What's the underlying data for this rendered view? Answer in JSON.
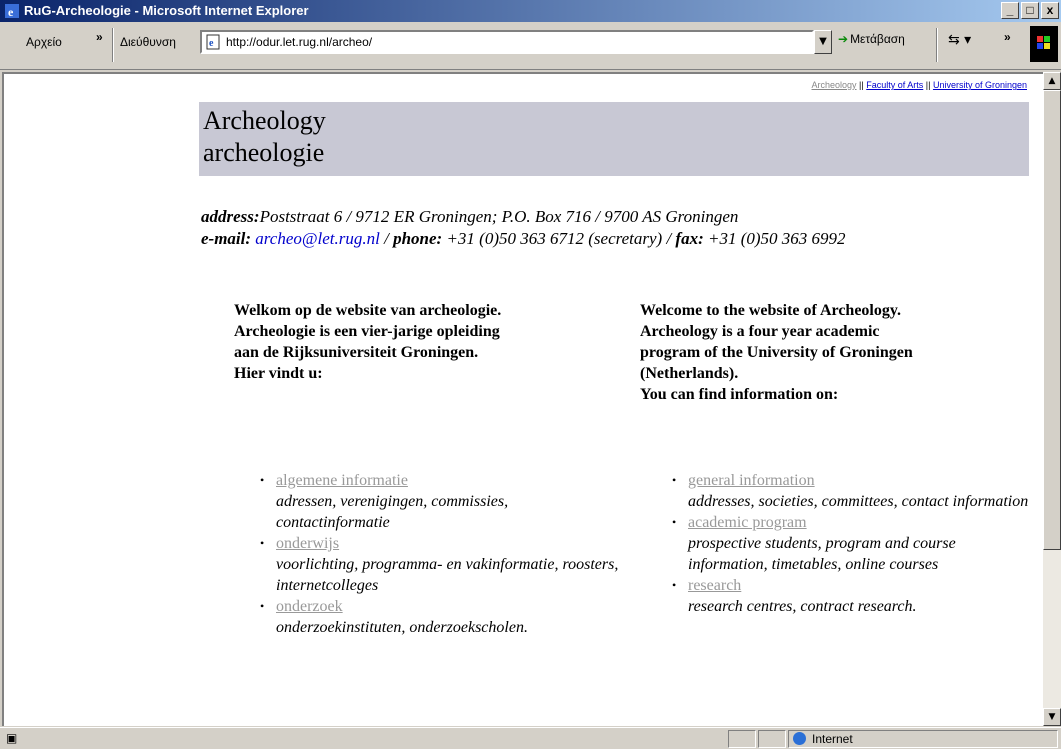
{
  "window": {
    "title": "RuG-Archeologie - Microsoft Internet Explorer",
    "minimize": "_",
    "maximize": "□",
    "close": "x"
  },
  "toolbar": {
    "file_menu": "Αρχείο",
    "chevron": "»",
    "address_label": "Διεύθυνση",
    "url": "http://odur.let.rug.nl/archeo/",
    "go_label": "Μετάβαση",
    "links_chevron": "»"
  },
  "page": {
    "toplinks": {
      "current": "Archeology",
      "sep1": " || ",
      "faculty": "Faculty of Arts",
      "sep2": " || ",
      "university": "University of Groningen"
    },
    "heading_en": "Archeology",
    "heading_nl": "archeologie",
    "contact": {
      "address_label": "address:",
      "address": "Poststraat 6 / 9712 ER Groningen; P.O. Box 716 / 9700 AS Groningen",
      "email_label": "e-mail:",
      "email": "archeo@let.rug.nl",
      "phone_label": "phone:",
      "phone": " +31 (0)50 363 6712 (secretary) / ",
      "fax_label": "fax:",
      "fax": " +31 (0)50 363 6992"
    },
    "intro_nl": {
      "l1": "Welkom op de website van archeologie.",
      "l2": "Archeologie is een vier-jarige opleiding",
      "l3": "aan de Rijksuniversiteit Groningen.",
      "l4": "Hier vindt u:"
    },
    "intro_en": {
      "l1": "Welcome to the website of Archeology.",
      "l2": "Archeology is a four year academic",
      "l3": "program of the University of Groningen",
      "l4": "(Netherlands).",
      "l5": "You can find information on:"
    },
    "items_nl": [
      {
        "link": "algemene informatie",
        "desc": "adressen, verenigingen, commissies, contactinformatie"
      },
      {
        "link": "onderwijs",
        "desc": "voorlichting, programma- en vakinformatie, roosters, internetcolleges"
      },
      {
        "link": "onderzoek",
        "desc": "onderzoekinstituten, onderzoekscholen."
      }
    ],
    "items_en": [
      {
        "link": "general information",
        "desc": "addresses, societies, committees, contact information"
      },
      {
        "link": "academic program",
        "desc": "prospective students, program and course information, timetables, online courses"
      },
      {
        "link": "research",
        "desc": "research centres, contract research."
      }
    ]
  },
  "statusbar": {
    "zone": "Internet"
  }
}
